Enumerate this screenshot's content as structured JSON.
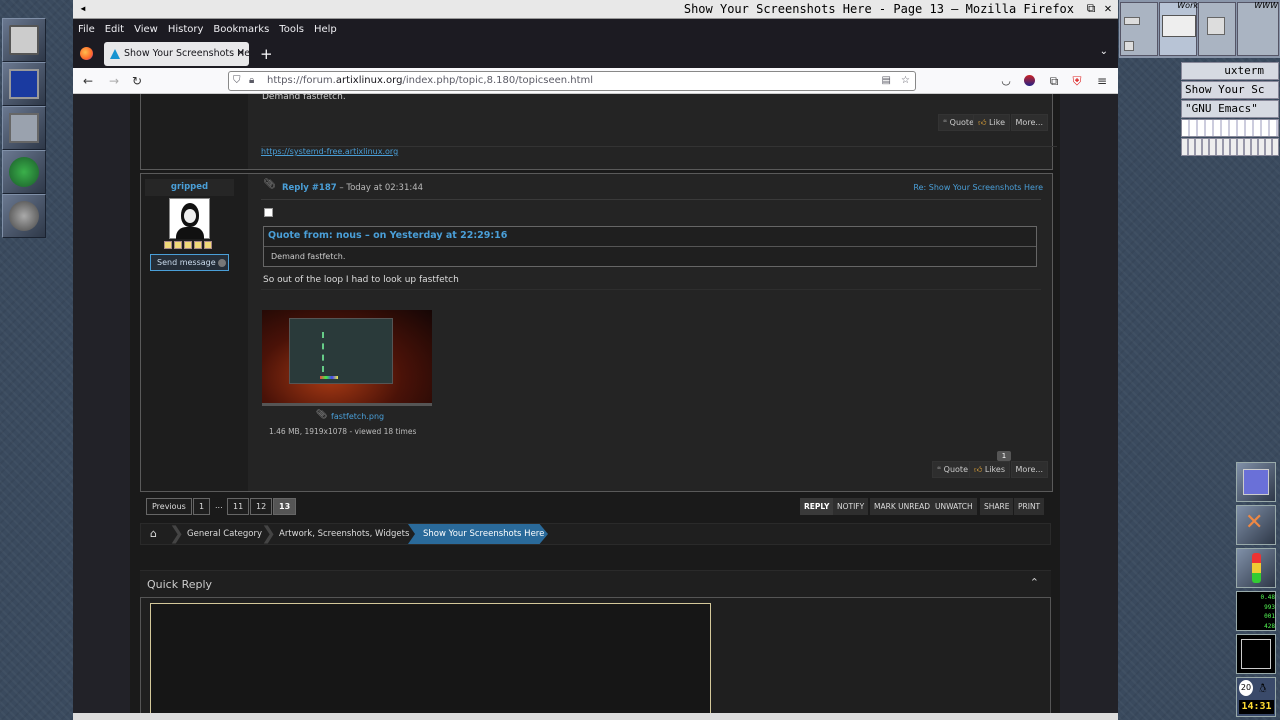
{
  "window_title": "Show Your Screenshots Here - Page 13 — Mozilla Firefox",
  "menu": [
    "File",
    "Edit",
    "View",
    "History",
    "Bookmarks",
    "Tools",
    "Help"
  ],
  "tab_title": "Show Your Screenshots He",
  "url": {
    "prefix": "https://forum.",
    "domain": "artixlinux.org",
    "path": "/index.php/topic,8.180/topicseen.html"
  },
  "prev_post": {
    "text": "Demand fastfetch.",
    "signature": "https://systemd-free.artixlinux.org",
    "buttons": [
      "Quote",
      "Like",
      "More..."
    ]
  },
  "post": {
    "author": "gripped",
    "send_message": "Send message",
    "reply_label": "Reply #187",
    "reply_time": "– Today at 02:31:44",
    "topic_link": "Re: Show Your Screenshots Here",
    "quote_header": "Quote from: nous – on Yesterday at 22:29:16",
    "quote_text": "Demand fastfetch.",
    "body": "So out of the loop I had to look up fastfetch",
    "attachment_name": "fastfetch.png",
    "attachment_meta": "1.46 MB, 1919x1078 - viewed 18 times",
    "likes_count": "1",
    "buttons": [
      "Quote",
      "Likes",
      "More..."
    ]
  },
  "pagination": [
    "Previous",
    "1",
    "...",
    "11",
    "12",
    "13"
  ],
  "actions": [
    "REPLY",
    "NOTIFY",
    "MARK UNREAD",
    "UNWATCH",
    "SHARE",
    "PRINT"
  ],
  "breadcrumb": [
    "General Category",
    "Artwork, Screenshots, Widgets",
    "Show Your Screenshots Here"
  ],
  "quick_reply": "Quick Reply",
  "pager_labels": [
    "Work",
    "WWW"
  ],
  "window_list": [
    "uxterm",
    "Show Your Sc",
    "\"GNU Emacs\"",
    "",
    ""
  ],
  "clock": {
    "day": "20",
    "time": "14:31"
  },
  "monitor_values": [
    "0.48",
    "993",
    "001",
    "428"
  ]
}
